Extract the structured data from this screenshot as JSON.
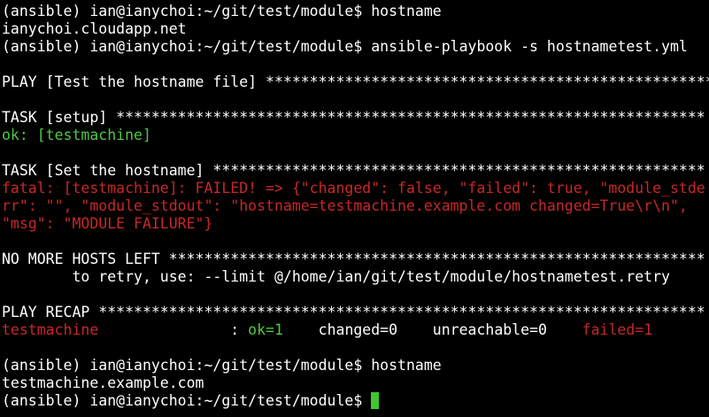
{
  "colors": {
    "background": "#000000",
    "text": "#ffffff",
    "ok_green": "#4ec940",
    "fail_red": "#c82727",
    "cursor_green": "#3ec92e"
  },
  "terminal": {
    "prompt": "(ansible) ian@ianychoi:~/git/test/module$ ",
    "lines": {
      "cmd1": "hostname",
      "out1": "ianychoi.cloudapp.net",
      "cmd2": "ansible-playbook -s hostnametest.yml",
      "play_header": "PLAY [Test the hostname file] ***************************************************",
      "task_setup_header": "TASK [setup] *******************************************************************",
      "task_setup_result": "ok: [testmachine]",
      "task_hostname_header": "TASK [Set the hostname] ********************************************************",
      "fatal_message": "fatal: [testmachine]: FAILED! => {\"changed\": false, \"failed\": true, \"module_stderr\": \"\", \"module_stdout\": \"hostname=testmachine.example.com changed=True\\r\\n\", \"msg\": \"MODULE FAILURE\"}",
      "no_more_hosts": "NO MORE HOSTS LEFT *************************************************************",
      "retry_hint": "        to retry, use: --limit @/home/ian/git/test/module/hostnametest.retry",
      "play_recap_header": "PLAY RECAP *********************************************************************",
      "cmd3": "hostname",
      "out3": "testmachine.example.com"
    },
    "recap": {
      "host": "testmachine               ",
      "sep": ": ",
      "ok": "ok=1",
      "changed": "    changed=0",
      "unreachable": "    unreachable=0",
      "failed": "    failed=1"
    }
  }
}
